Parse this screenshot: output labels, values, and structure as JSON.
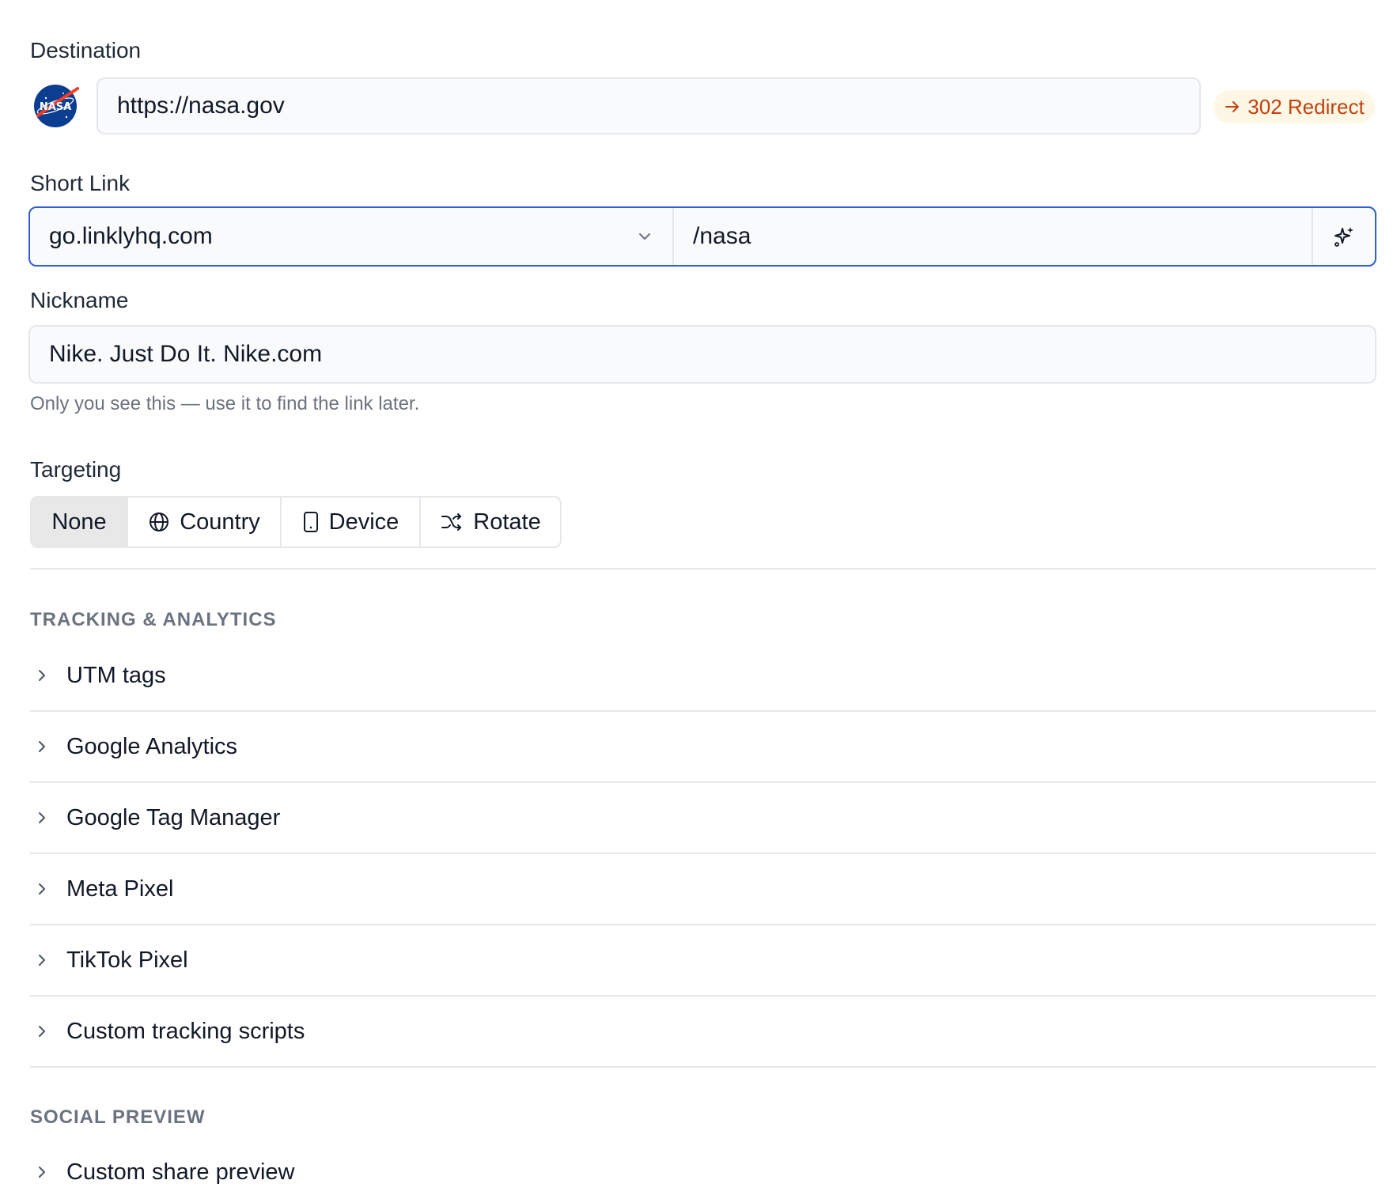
{
  "destination": {
    "label": "Destination",
    "logo_icon": "nasa-logo",
    "logo_text": "NASA",
    "url_value": "https://nasa.gov",
    "redirect_badge": "302 Redirect",
    "badge_color": "#c2410c"
  },
  "short_link": {
    "label": "Short Link",
    "domain_value": "go.linklyhq.com",
    "slug_value": "/nasa",
    "generate_icon": "sparkle-icon",
    "focus_color": "#2f5fd0"
  },
  "nickname": {
    "label": "Nickname",
    "value": "Nike. Just Do It. Nike.com",
    "helper": "Only you see this — use it to find the link later."
  },
  "targeting": {
    "label": "Targeting",
    "options": [
      {
        "label": "None",
        "icon": "",
        "active": true
      },
      {
        "label": "Country",
        "icon": "globe-icon",
        "active": false
      },
      {
        "label": "Device",
        "icon": "phone-icon",
        "active": false
      },
      {
        "label": "Rotate",
        "icon": "shuffle-icon",
        "active": false
      }
    ]
  },
  "tracking": {
    "heading": "TRACKING & ANALYTICS",
    "items": [
      {
        "label": "UTM tags"
      },
      {
        "label": "Google Analytics"
      },
      {
        "label": "Google Tag Manager"
      },
      {
        "label": "Meta Pixel"
      },
      {
        "label": "TikTok Pixel"
      },
      {
        "label": "Custom tracking scripts"
      }
    ]
  },
  "social": {
    "heading": "SOCIAL PREVIEW",
    "items": [
      {
        "label": "Custom share preview"
      }
    ]
  }
}
